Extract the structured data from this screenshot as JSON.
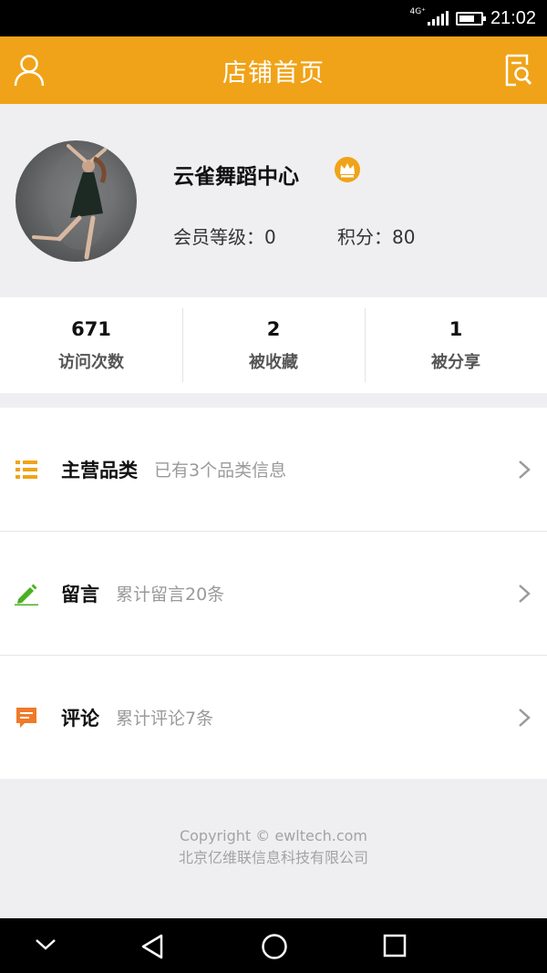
{
  "status_bar": {
    "network": "4G⁺",
    "time": "21:02"
  },
  "header": {
    "title": "店铺首页",
    "left_icon": "user-icon",
    "right_icon": "search-document-icon"
  },
  "profile": {
    "shop_name": "云雀舞蹈中心",
    "badge_icon": "crown-icon",
    "member_level": "会员等级：0",
    "points": "积分：80"
  },
  "counts": [
    {
      "value": "671",
      "label": "访问次数"
    },
    {
      "value": "2",
      "label": "被收藏"
    },
    {
      "value": "1",
      "label": "被分享"
    }
  ],
  "menu": [
    {
      "icon": "list-icon",
      "title": "主营品类",
      "desc": "已有3个品类信息",
      "color": "#f0a318"
    },
    {
      "icon": "pencil-icon",
      "title": "留言",
      "desc": "累计留言20条",
      "color": "#4caf22"
    },
    {
      "icon": "comment-icon",
      "title": "评论",
      "desc": "累计评论7条",
      "color": "#f07a28"
    }
  ],
  "footer": {
    "copyright": "Copyright © ewltech.com",
    "company": "北京亿维联信息科技有限公司"
  },
  "colors": {
    "accent": "#f0a318",
    "background": "#efeff2"
  }
}
